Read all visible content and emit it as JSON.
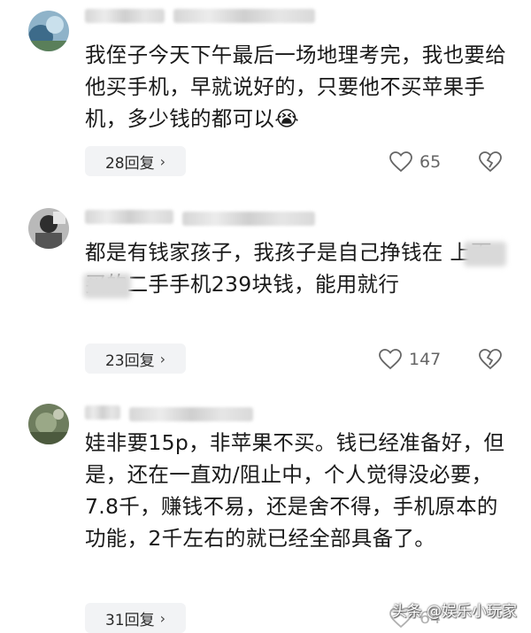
{
  "comments": [
    {
      "text": "我侄子今天下午最后一场地理考完，我也要给他买手机，早就说好的，只要他不买苹果手机，多少钱的都可以😭",
      "reply_label": "28回复",
      "likes": "65"
    },
    {
      "text": "都是有钱家孩子，我孩子是自己挣钱在 上面买的二手手机239块钱，能用就行",
      "reply_label": "23回复",
      "likes": "147"
    },
    {
      "text": "娃非要15p，非苹果不买。钱已经准备好，但是，还在一直劝/阻止中，个人觉得没必要，7.8千，赚钱不易，还是舍不得，手机原本的功能，2千左右的就已经全部具备了。",
      "reply_label": "31回复",
      "likes": "64"
    }
  ],
  "watermark": "头条 @娱乐小玩家",
  "icons": {
    "like": "heart-icon",
    "dislike": "broken-heart-icon",
    "chevron": "chevron-right-icon"
  }
}
